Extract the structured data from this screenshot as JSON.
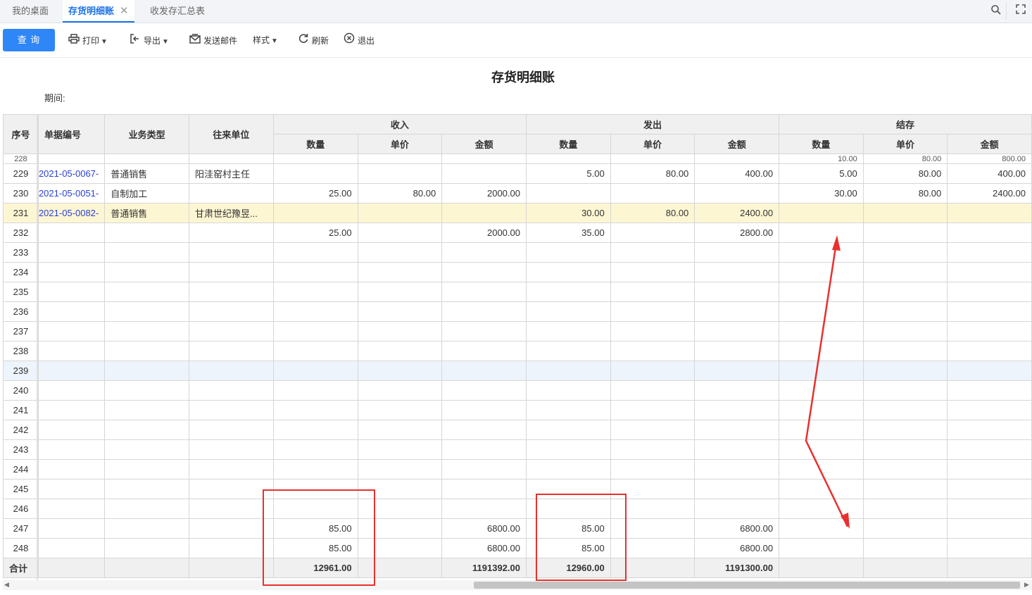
{
  "tabs": [
    {
      "label": "我的桌面"
    },
    {
      "label": "存货明细账",
      "close": "✕"
    },
    {
      "label": "收发存汇总表"
    }
  ],
  "toolbar": {
    "query": "查 询",
    "print": "打印",
    "export": "导出",
    "email": "发送邮件",
    "style": "样式",
    "refresh": "刷新",
    "exit": "退出"
  },
  "report": {
    "title": "存货明细账",
    "period_label": "期间:"
  },
  "table": {
    "headers": {
      "index": "序号",
      "doc_no": "单据编号",
      "biz_type": "业务类型",
      "partner": "往来单位",
      "in": "收入",
      "out": "发出",
      "balance": "结存",
      "qty": "数量",
      "price": "单价",
      "amount": "金额"
    },
    "partial_row": {
      "index": "228",
      "bal_qty": "10.00",
      "bal_price": "80.00",
      "bal_amount": "800.00"
    },
    "rows": [
      {
        "index": "229",
        "doc_no": "-2021-05-0067",
        "biz_type": "普通销售",
        "partner": "阳洼窑村主任",
        "in_qty": "",
        "in_price": "",
        "in_amount": "",
        "out_qty": "5.00",
        "out_price": "80.00",
        "out_amount": "400.00",
        "bal_qty": "5.00",
        "bal_price": "80.00",
        "bal_amount": "400.00"
      },
      {
        "index": "230",
        "doc_no": "-2021-05-0051",
        "biz_type": "自制加工",
        "partner": "",
        "in_qty": "25.00",
        "in_price": "80.00",
        "in_amount": "2000.00",
        "out_qty": "",
        "out_price": "",
        "out_amount": "",
        "bal_qty": "30.00",
        "bal_price": "80.00",
        "bal_amount": "2400.00"
      },
      {
        "index": "231",
        "doc_no": "-2021-05-0082",
        "biz_type": "普通销售",
        "partner": "甘肃世纪豫昱...",
        "in_qty": "",
        "in_price": "",
        "in_amount": "",
        "out_qty": "30.00",
        "out_price": "80.00",
        "out_amount": "2400.00",
        "bal_qty": "",
        "bal_price": "",
        "bal_amount": ""
      },
      {
        "index": "232",
        "doc_no": "",
        "biz_type": "",
        "partner": "",
        "in_qty": "25.00",
        "in_price": "",
        "in_amount": "2000.00",
        "out_qty": "35.00",
        "out_price": "",
        "out_amount": "2800.00",
        "bal_qty": "",
        "bal_price": "",
        "bal_amount": ""
      },
      {
        "index": "233",
        "doc_no": "",
        "biz_type": "",
        "partner": "",
        "in_qty": "",
        "in_price": "",
        "in_amount": "",
        "out_qty": "",
        "out_price": "",
        "out_amount": "",
        "bal_qty": "",
        "bal_price": "",
        "bal_amount": ""
      },
      {
        "index": "234",
        "doc_no": "",
        "biz_type": "",
        "partner": "",
        "in_qty": "",
        "in_price": "",
        "in_amount": "",
        "out_qty": "",
        "out_price": "",
        "out_amount": "",
        "bal_qty": "",
        "bal_price": "",
        "bal_amount": ""
      },
      {
        "index": "235",
        "doc_no": "",
        "biz_type": "",
        "partner": "",
        "in_qty": "",
        "in_price": "",
        "in_amount": "",
        "out_qty": "",
        "out_price": "",
        "out_amount": "",
        "bal_qty": "",
        "bal_price": "",
        "bal_amount": ""
      },
      {
        "index": "236",
        "doc_no": "",
        "biz_type": "",
        "partner": "",
        "in_qty": "",
        "in_price": "",
        "in_amount": "",
        "out_qty": "",
        "out_price": "",
        "out_amount": "",
        "bal_qty": "",
        "bal_price": "",
        "bal_amount": ""
      },
      {
        "index": "237",
        "doc_no": "",
        "biz_type": "",
        "partner": "",
        "in_qty": "",
        "in_price": "",
        "in_amount": "",
        "out_qty": "",
        "out_price": "",
        "out_amount": "",
        "bal_qty": "",
        "bal_price": "",
        "bal_amount": ""
      },
      {
        "index": "238",
        "doc_no": "",
        "biz_type": "",
        "partner": "",
        "in_qty": "",
        "in_price": "",
        "in_amount": "",
        "out_qty": "",
        "out_price": "",
        "out_amount": "",
        "bal_qty": "",
        "bal_price": "",
        "bal_amount": ""
      },
      {
        "index": "239",
        "doc_no": "",
        "biz_type": "",
        "partner": "",
        "in_qty": "",
        "in_price": "",
        "in_amount": "",
        "out_qty": "",
        "out_price": "",
        "out_amount": "",
        "bal_qty": "",
        "bal_price": "",
        "bal_amount": ""
      },
      {
        "index": "240",
        "doc_no": "",
        "biz_type": "",
        "partner": "",
        "in_qty": "",
        "in_price": "",
        "in_amount": "",
        "out_qty": "",
        "out_price": "",
        "out_amount": "",
        "bal_qty": "",
        "bal_price": "",
        "bal_amount": ""
      },
      {
        "index": "241",
        "doc_no": "",
        "biz_type": "",
        "partner": "",
        "in_qty": "",
        "in_price": "",
        "in_amount": "",
        "out_qty": "",
        "out_price": "",
        "out_amount": "",
        "bal_qty": "",
        "bal_price": "",
        "bal_amount": ""
      },
      {
        "index": "242",
        "doc_no": "",
        "biz_type": "",
        "partner": "",
        "in_qty": "",
        "in_price": "",
        "in_amount": "",
        "out_qty": "",
        "out_price": "",
        "out_amount": "",
        "bal_qty": "",
        "bal_price": "",
        "bal_amount": ""
      },
      {
        "index": "243",
        "doc_no": "",
        "biz_type": "",
        "partner": "",
        "in_qty": "",
        "in_price": "",
        "in_amount": "",
        "out_qty": "",
        "out_price": "",
        "out_amount": "",
        "bal_qty": "",
        "bal_price": "",
        "bal_amount": ""
      },
      {
        "index": "244",
        "doc_no": "",
        "biz_type": "",
        "partner": "",
        "in_qty": "",
        "in_price": "",
        "in_amount": "",
        "out_qty": "",
        "out_price": "",
        "out_amount": "",
        "bal_qty": "",
        "bal_price": "",
        "bal_amount": ""
      },
      {
        "index": "245",
        "doc_no": "",
        "biz_type": "",
        "partner": "",
        "in_qty": "",
        "in_price": "",
        "in_amount": "",
        "out_qty": "",
        "out_price": "",
        "out_amount": "",
        "bal_qty": "",
        "bal_price": "",
        "bal_amount": ""
      },
      {
        "index": "246",
        "doc_no": "",
        "biz_type": "",
        "partner": "",
        "in_qty": "",
        "in_price": "",
        "in_amount": "",
        "out_qty": "",
        "out_price": "",
        "out_amount": "",
        "bal_qty": "",
        "bal_price": "",
        "bal_amount": ""
      },
      {
        "index": "247",
        "doc_no": "",
        "biz_type": "",
        "partner": "",
        "in_qty": "85.00",
        "in_price": "",
        "in_amount": "6800.00",
        "out_qty": "85.00",
        "out_price": "",
        "out_amount": "6800.00",
        "bal_qty": "",
        "bal_price": "",
        "bal_amount": ""
      },
      {
        "index": "248",
        "doc_no": "",
        "biz_type": "",
        "partner": "",
        "in_qty": "85.00",
        "in_price": "",
        "in_amount": "6800.00",
        "out_qty": "85.00",
        "out_price": "",
        "out_amount": "6800.00",
        "bal_qty": "",
        "bal_price": "",
        "bal_amount": ""
      }
    ],
    "highlighted_row": "231",
    "selected_row": "239",
    "total": {
      "label": "合计",
      "in_qty": "12961.00",
      "in_amount": "1191392.00",
      "out_qty": "12960.00",
      "out_amount": "1191300.00"
    }
  },
  "colors": {
    "accent": "#2f86f6",
    "doc_link": "#2a3fd6",
    "highlight_row": "#fdf6d3",
    "annotation_red": "#e8302e"
  }
}
